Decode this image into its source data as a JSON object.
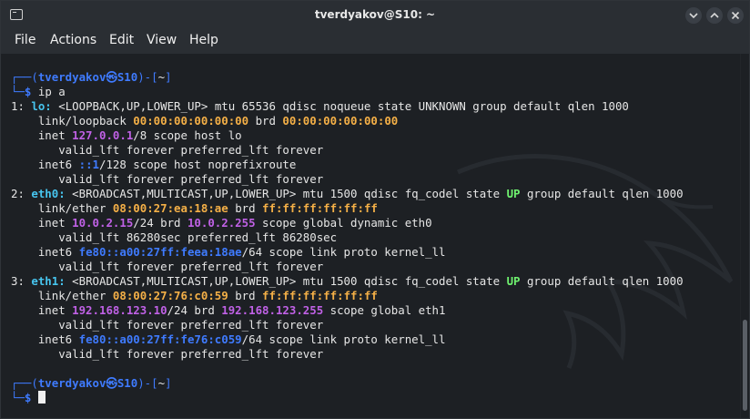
{
  "window": {
    "title": "tverdyakov@S10: ~"
  },
  "menu": [
    "File",
    "Actions",
    "Edit",
    "View",
    "Help"
  ],
  "terminal": {
    "prompt": {
      "user_host": "tverdyakov㉿S10",
      "cwd": "~",
      "top_prefix": "┌──(",
      "top_mid": ")-[",
      "top_end": "]",
      "bottom_prefix": "└─",
      "dollar": "$"
    },
    "command": "ip a",
    "output": {
      "lo": {
        "idx": "1: ",
        "name": "lo:",
        "flags_line": " <LOOPBACK,UP,LOWER_UP> mtu 65536 qdisc noqueue state UNKNOWN group default qlen 1000",
        "link_prefix": "    link/loopback ",
        "link_mac": "00:00:00:00:00:00",
        "brd_label": " brd ",
        "brd_mac": "00:00:00:00:00:00",
        "inet_prefix": "    inet ",
        "inet_ip": "127.0.0.1",
        "inet_suffix": "/8 scope host lo",
        "valid1": "       valid_lft forever preferred_lft forever",
        "inet6_prefix": "    inet6 ",
        "inet6_ip": "::1",
        "inet6_suffix": "/128 scope host noprefixroute",
        "valid2": "       valid_lft forever preferred_lft forever"
      },
      "eth0": {
        "idx": "2: ",
        "name": "eth0:",
        "flags_a": " <BROADCAST,MULTICAST,UP,LOWER_UP> mtu 1500 qdisc fq_codel state ",
        "state": "UP",
        "flags_b": " group default qlen 1000",
        "link_prefix": "    link/ether ",
        "link_mac": "08:00:27:ea:18:ae",
        "brd_label": " brd ",
        "brd_mac": "ff:ff:ff:ff:ff:ff",
        "inet_prefix": "    inet ",
        "inet_ip": "10.0.2.15",
        "inet_mid": "/24 brd ",
        "inet_brd": "10.0.2.255",
        "inet_suffix": " scope global dynamic eth0",
        "valid1": "       valid_lft 86280sec preferred_lft 86280sec",
        "inet6_prefix": "    inet6 ",
        "inet6_ip": "fe80::a00:27ff:feea:18ae",
        "inet6_suffix": "/64 scope link proto kernel_ll",
        "valid2": "       valid_lft forever preferred_lft forever"
      },
      "eth1": {
        "idx": "3: ",
        "name": "eth1:",
        "flags_a": " <BROADCAST,MULTICAST,UP,LOWER_UP> mtu 1500 qdisc fq_codel state ",
        "state": "UP",
        "flags_b": " group default qlen 1000",
        "link_prefix": "    link/ether ",
        "link_mac": "08:00:27:76:c0:59",
        "brd_label": " brd ",
        "brd_mac": "ff:ff:ff:ff:ff:ff",
        "inet_prefix": "    inet ",
        "inet_ip": "192.168.123.10",
        "inet_mid": "/24 brd ",
        "inet_brd": "192.168.123.255",
        "inet_suffix": " scope global eth1",
        "valid1": "       valid_lft forever preferred_lft forever",
        "inet6_prefix": "    inet6 ",
        "inet6_ip": "fe80::a00:27ff:fe76:c059",
        "inet6_suffix": "/64 scope link proto kernel_ll",
        "valid2": "       valid_lft forever preferred_lft forever"
      }
    }
  },
  "colors": {
    "prompt_blue": "#3f7bff",
    "mac_orange": "#f5b047",
    "ip_purple": "#c061e6",
    "state_green": "#6ff26f",
    "iface_cyan": "#47c5ef"
  }
}
